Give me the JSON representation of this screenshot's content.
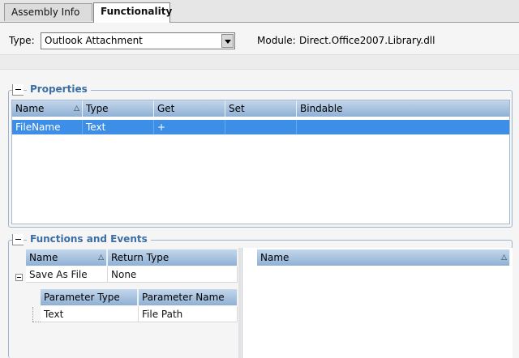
{
  "tabs": [
    {
      "label": "Assembly Info",
      "active": false
    },
    {
      "label": "Functionality",
      "active": true
    }
  ],
  "type_row": {
    "label": "Type:",
    "value": "Outlook Attachment",
    "module_label": "Module:",
    "module_value": "Direct.Office2007.Library.dll"
  },
  "properties": {
    "title": "Properties",
    "columns": [
      "Name",
      "Type",
      "Get",
      "Set",
      "Bindable"
    ],
    "rows": [
      {
        "name": "FileName",
        "type": "Text",
        "get": "+",
        "set": "",
        "bindable": "",
        "selected": true
      }
    ]
  },
  "functions": {
    "title": "Functions and Events",
    "columns": [
      "Name",
      "Return Type"
    ],
    "rows": [
      {
        "name": "Save As File",
        "return_type": "None",
        "expanded": true
      }
    ],
    "param_columns": [
      "Parameter Type",
      "Parameter Name"
    ],
    "params": [
      {
        "type": "Text",
        "name": "File Path"
      }
    ],
    "events_columns": [
      "Name"
    ]
  },
  "colors": {
    "selection": "#3d8ee6",
    "group_title": "#3b6ea5",
    "header_top": "#c3d7ec",
    "header_bottom": "#8fb0d4"
  }
}
